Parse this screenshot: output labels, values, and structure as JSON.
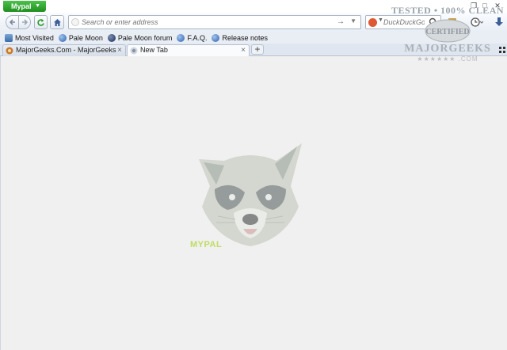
{
  "app": {
    "menu_label": "Mypal"
  },
  "nav": {
    "url_placeholder": "Search or enter address",
    "search_placeholder": "DuckDuckGo"
  },
  "bookmarks": [
    {
      "label": "Most Visited"
    },
    {
      "label": "Pale Moon"
    },
    {
      "label": "Pale Moon forum"
    },
    {
      "label": "F.A.Q."
    },
    {
      "label": "Release notes"
    }
  ],
  "tabs": [
    {
      "label": "MajorGeeks.Com - MajorGeeks",
      "active": false
    },
    {
      "label": "New Tab",
      "active": true
    }
  ],
  "content": {
    "brand_text": "MYPAL"
  },
  "watermark": {
    "top_text": "TESTED • 100% CLEAN",
    "badge_text": "CERTIFIED",
    "site_text": "MAJORGEEKS",
    "bottom_text": "★★★★★★ .COM"
  },
  "colors": {
    "accent": "#2da52d",
    "toolbar": "#e9eef5",
    "content_bg": "#f0f0f0"
  }
}
